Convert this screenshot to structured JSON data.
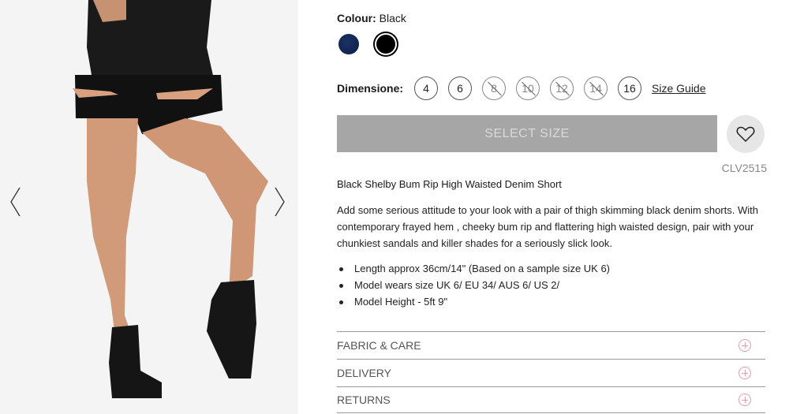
{
  "product": {
    "colour_label": "Colour:",
    "colour_value": "Black",
    "size_label": "Dimensione:",
    "sizes": [
      "4",
      "6",
      "8",
      "10",
      "12",
      "14",
      "16"
    ],
    "size_guide": "Size Guide",
    "select_size": "SELECT SIZE",
    "sku": "CLV2515",
    "title": "Black Shelby Bum Rip High Waisted Denim Short",
    "description": "Add some serious attitude to your look with a pair of thigh skimming black denim shorts. With contemporary frayed hem , cheeky bum rip and flattering high waisted design, pair with your chunkiest sandals and killer shades for a seriously slick look.",
    "bullets": [
      "Length approx 36cm/14\" (Based on a sample size UK 6)",
      "Model wears size UK 6/ EU 34/ AUS 6/ US 2/",
      "Model Height - 5ft 9\""
    ]
  },
  "accordion": [
    "FABRIC & CARE",
    "DELIVERY",
    "RETURNS"
  ],
  "colors": {
    "navy_swatch": "#0c1d45",
    "black_swatch": "#000000",
    "select_button": "#a6a6a6",
    "accent_plus": "#e3a0a8"
  },
  "icons": [
    "chevron-left-icon",
    "chevron-right-icon",
    "heart-icon",
    "plus-circle-icon"
  ]
}
